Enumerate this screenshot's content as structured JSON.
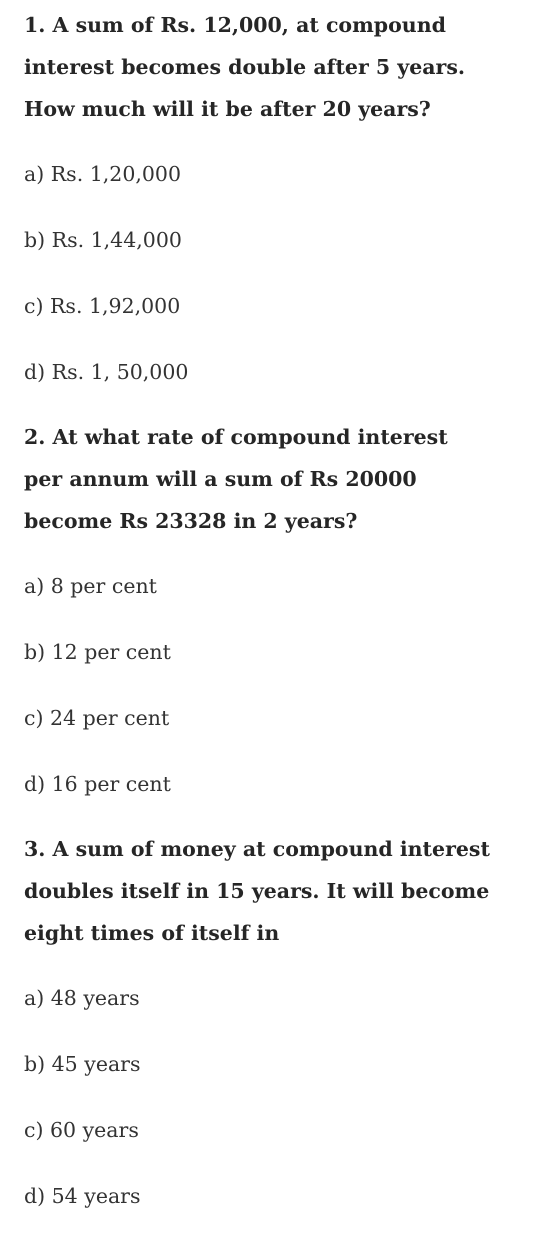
{
  "questions": [
    {
      "text_lines": [
        "1. A sum of Rs. 12,000, at compound",
        "interest becomes double after 5 years.",
        "How much will it be after 20 years?"
      ],
      "options": [
        "a) Rs. 1,20,000",
        "b) Rs. 1,44,000",
        "c) Rs. 1,92,000",
        "d) Rs. 1, 50,000"
      ]
    },
    {
      "text_lines": [
        "2. At what rate of compound interest",
        "per annum will a sum of Rs 20000",
        "become Rs 23328 in 2 years?"
      ],
      "options": [
        "a) 8 per cent",
        "b) 12 per cent",
        "c) 24 per cent",
        "d) 16 per cent"
      ]
    },
    {
      "text_lines": [
        "3. A sum of money at compound interest",
        "doubles itself in 15 years. It will become",
        "eight times of itself in"
      ],
      "options": [
        "a) 48 years",
        "b) 45 years",
        "c) 60 years",
        "d) 54 years"
      ]
    }
  ]
}
